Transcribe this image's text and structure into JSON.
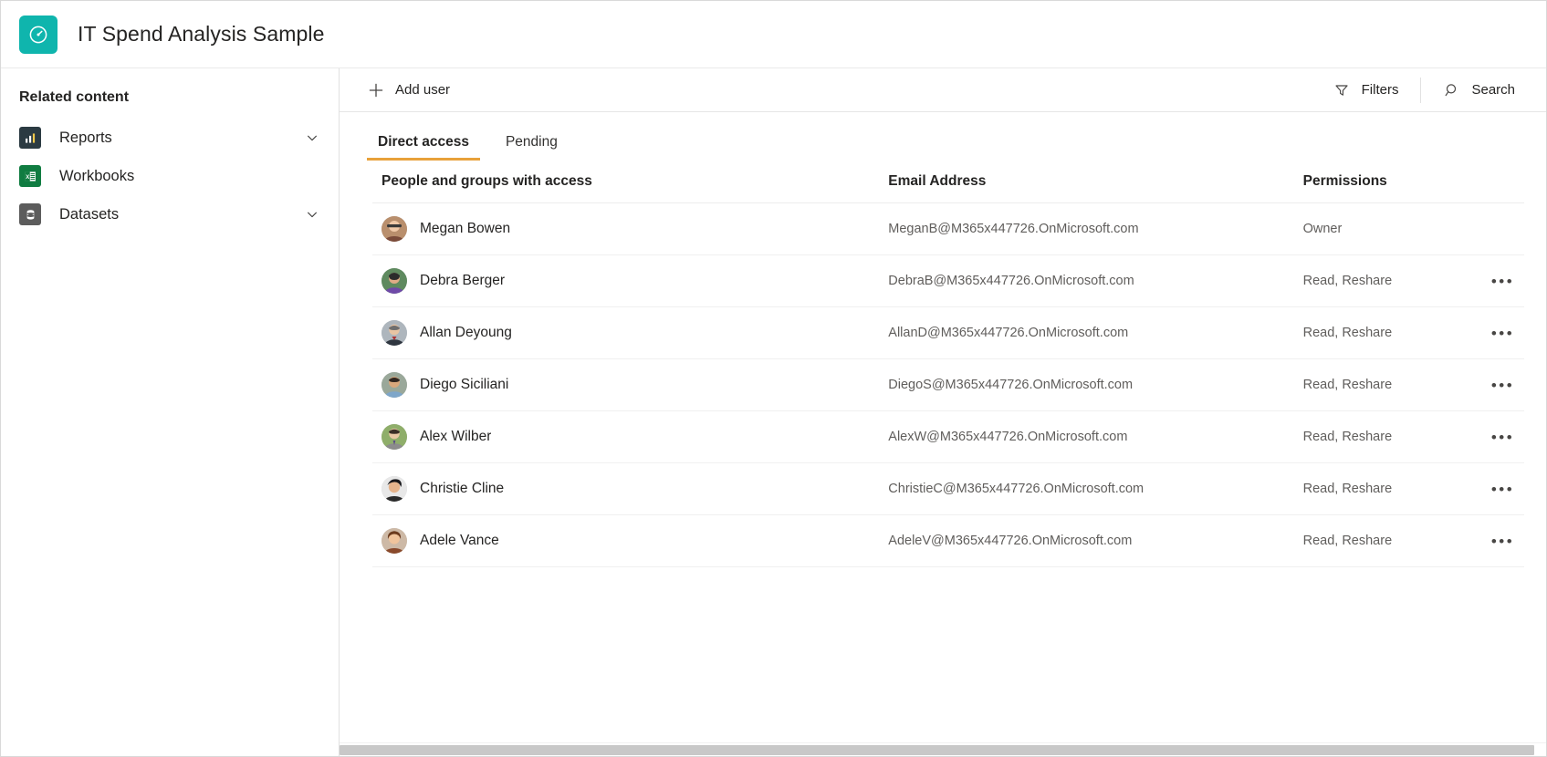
{
  "header": {
    "app_icon": "gauge-icon",
    "icon_color": "#0fb5ad",
    "title": "IT Spend Analysis Sample"
  },
  "sidebar": {
    "heading": "Related content",
    "items": [
      {
        "label": "Reports",
        "icon": "bar-chart-icon",
        "icon_color": "#2b3a42",
        "expandable": true
      },
      {
        "label": "Workbooks",
        "icon": "excel-workbook-icon",
        "icon_color": "#107c41",
        "expandable": false
      },
      {
        "label": "Datasets",
        "icon": "database-icon",
        "icon_color": "#5c5c5c",
        "expandable": true
      }
    ]
  },
  "toolbar": {
    "add_user_label": "Add user",
    "add_user_icon": "plus-icon",
    "filters_label": "Filters",
    "filters_icon": "funnel-icon",
    "search_label": "Search",
    "search_icon": "search-icon"
  },
  "tabs": [
    {
      "label": "Direct access",
      "active": true
    },
    {
      "label": "Pending",
      "active": false
    }
  ],
  "tab_accent_color": "#e8a13a",
  "table": {
    "columns": [
      "People and groups with access",
      "Email Address",
      "Permissions"
    ],
    "rows": [
      {
        "name": "Megan Bowen",
        "email": "MeganB@M365x447726.OnMicrosoft.com",
        "permission": "Owner",
        "has_menu": false
      },
      {
        "name": "Debra Berger",
        "email": "DebraB@M365x447726.OnMicrosoft.com",
        "permission": "Read, Reshare",
        "has_menu": true
      },
      {
        "name": "Allan Deyoung",
        "email": "AllanD@M365x447726.OnMicrosoft.com",
        "permission": "Read, Reshare",
        "has_menu": true
      },
      {
        "name": "Diego Siciliani",
        "email": "DiegoS@M365x447726.OnMicrosoft.com",
        "permission": "Read, Reshare",
        "has_menu": true
      },
      {
        "name": "Alex Wilber",
        "email": "AlexW@M365x447726.OnMicrosoft.com",
        "permission": "Read, Reshare",
        "has_menu": true
      },
      {
        "name": "Christie Cline",
        "email": "ChristieC@M365x447726.OnMicrosoft.com",
        "permission": "Read, Reshare",
        "has_menu": true
      },
      {
        "name": "Adele Vance",
        "email": "AdeleV@M365x447726.OnMicrosoft.com",
        "permission": "Read, Reshare",
        "has_menu": true
      }
    ],
    "row_menu_glyph": "•••"
  }
}
